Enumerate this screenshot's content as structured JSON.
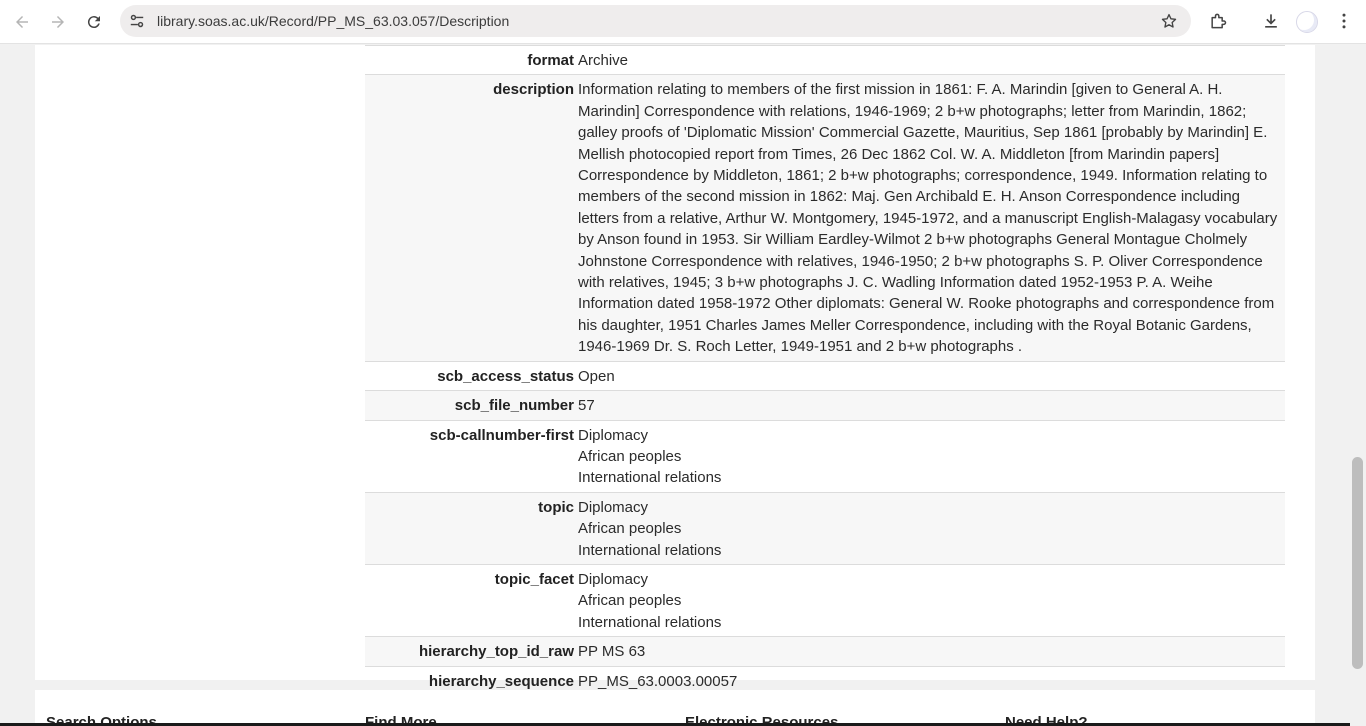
{
  "browser": {
    "url": "library.soas.ac.uk/Record/PP_MS_63.03.057/Description"
  },
  "record": {
    "format": {
      "key": "format",
      "value": "Archive"
    },
    "description": {
      "key": "description",
      "value": "Information relating to members of the first mission in 1861: F. A. Marindin [given to General A. H. Marindin] Correspondence with relations, 1946-1969; 2 b+w photographs; letter from Marindin, 1862; galley proofs of 'Diplomatic Mission' Commercial Gazette, Mauritius, Sep 1861 [probably by Marindin] E. Mellish photocopied report from Times, 26 Dec 1862 Col. W. A. Middleton [from Marindin papers] Correspondence by Middleton, 1861; 2 b+w photographs; correspondence, 1949. Information relating to members of the second mission in 1862: Maj. Gen Archibald E. H. Anson Correspondence including letters from a relative, Arthur W. Montgomery, 1945-1972, and a manuscript English-Malagasy vocabulary by Anson found in 1953. Sir William Eardley-Wilmot 2 b+w photographs General Montague Cholmely Johnstone Correspondence with relatives, 1946-1950; 2 b+w photographs S. P. Oliver Correspondence with relatives, 1945; 3 b+w photographs J. C. Wadling Information dated 1952-1953 P. A. Weihe Information dated 1958-1972 Other diplomats: General W. Rooke photographs and correspondence from his daughter, 1951 Charles James Meller Correspondence, including with the Royal Botanic Gardens, 1946-1969 Dr. S. Roch Letter, 1949-1951 and 2 b+w photographs ."
    },
    "scb_access_status": {
      "key": "scb_access_status",
      "value": "Open"
    },
    "scb_file_number": {
      "key": "scb_file_number",
      "value": "57"
    },
    "scb_callnumber_first": {
      "key": "scb-callnumber-first",
      "values": [
        "Diplomacy",
        "African peoples",
        "International relations"
      ]
    },
    "topic": {
      "key": "topic",
      "values": [
        "Diplomacy",
        "African peoples",
        "International relations"
      ]
    },
    "topic_facet": {
      "key": "topic_facet",
      "values": [
        "Diplomacy",
        "African peoples",
        "International relations"
      ]
    },
    "hierarchy_top_id_raw": {
      "key": "hierarchy_top_id_raw",
      "value": "PP MS 63"
    },
    "hierarchy_sequence": {
      "key": "hierarchy_sequence",
      "value": "PP_MS_63.0003.00057"
    }
  },
  "footer": {
    "columns": [
      "Search Options",
      "Find More",
      "Electronic Resources",
      "Need Help?"
    ]
  }
}
